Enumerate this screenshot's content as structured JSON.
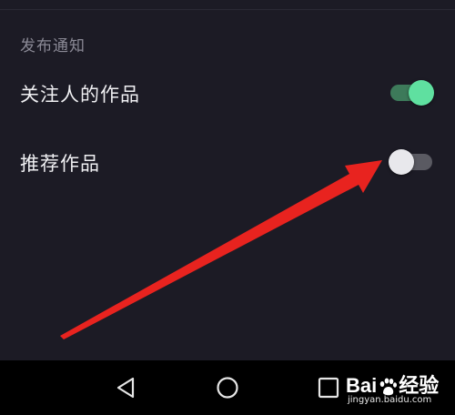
{
  "settings": {
    "section_title": "发布通知",
    "items": [
      {
        "label": "关注人的作品",
        "toggle_on": true
      },
      {
        "label": "推荐作品",
        "toggle_on": false
      }
    ]
  },
  "colors": {
    "background": "#1c1b25",
    "toggle_on_thumb": "#5fe0a0",
    "toggle_on_track": "#3d7a5a",
    "toggle_off_thumb": "#e8e8ec",
    "toggle_off_track": "#5a5a62",
    "annotation_arrow": "#e8231f"
  },
  "nav_bar": {
    "icons": [
      "back-triangle-icon",
      "home-circle-icon",
      "recents-square-icon"
    ]
  },
  "watermark": {
    "brand_prefix": "Bai",
    "brand_suffix": "经验",
    "url": "jingyan.baidu.com"
  }
}
